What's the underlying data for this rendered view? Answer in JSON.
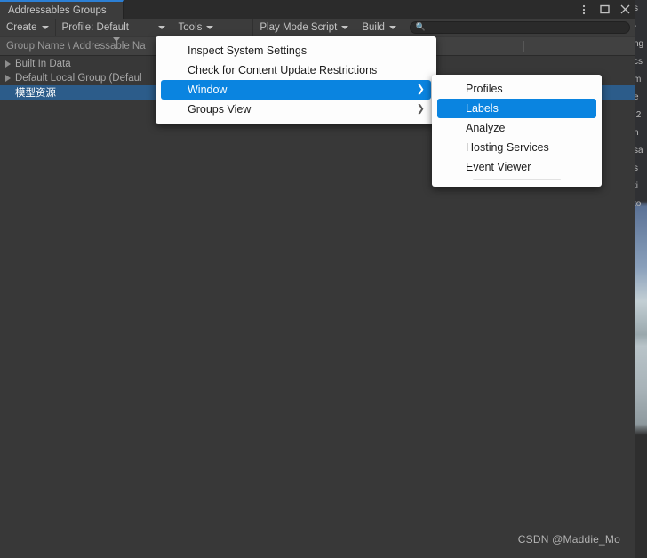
{
  "window": {
    "tab_label": "Addressables Groups",
    "controls": [
      {
        "name": "more-options-icon",
        "glyph": "kebab"
      },
      {
        "name": "maximize-icon",
        "glyph": "square"
      },
      {
        "name": "close-icon",
        "glyph": "cross"
      }
    ]
  },
  "toolbar": {
    "create_label": "Create",
    "profile_label": "Profile: Default",
    "tools_label": "Tools",
    "play_mode_script_label": "Play Mode Script",
    "build_label": "Build",
    "search_placeholder": "",
    "search_value": "",
    "search_icon": "search-icon"
  },
  "columns": {
    "group_name": "Group Name \\ Addressable Na"
  },
  "tree": {
    "rows": [
      {
        "label": "Built In Data",
        "expandable": true,
        "selected": false
      },
      {
        "label": "Default Local Group (Defaul",
        "expandable": true,
        "selected": false
      },
      {
        "label": "模型资源",
        "expandable": false,
        "selected": true
      }
    ]
  },
  "menus": {
    "tools": {
      "items": [
        {
          "label": "Inspect System Settings",
          "submenu": false,
          "highlighted": false
        },
        {
          "label": "Check for Content Update Restrictions",
          "submenu": false,
          "highlighted": false
        },
        {
          "label": "Window",
          "submenu": true,
          "highlighted": true
        },
        {
          "label": "Groups View",
          "submenu": true,
          "highlighted": false
        }
      ]
    },
    "window": {
      "items": [
        {
          "label": "Profiles",
          "submenu": false,
          "highlighted": false
        },
        {
          "label": "Labels",
          "submenu": false,
          "highlighted": true
        },
        {
          "label": "Analyze",
          "submenu": false,
          "highlighted": false
        },
        {
          "label": "Hosting Services",
          "submenu": false,
          "highlighted": false
        },
        {
          "label": "Event Viewer",
          "submenu": false,
          "highlighted": false
        }
      ]
    }
  },
  "background_fragments": [
    "s",
    "-",
    "ng",
    "cs",
    "m",
    "e",
    ".2",
    "n",
    "sa",
    "s",
    "ti",
    "to"
  ],
  "watermark": "CSDN @Maddie_Mo",
  "colors": {
    "accent_blue": "#0a84e0",
    "selection_blue": "#2c5c8a",
    "tab_accent": "#2c7fd4",
    "panel_bg": "#383838",
    "toolbar_bg": "#3c3c3c",
    "menu_bg": "#fdfdfd"
  }
}
